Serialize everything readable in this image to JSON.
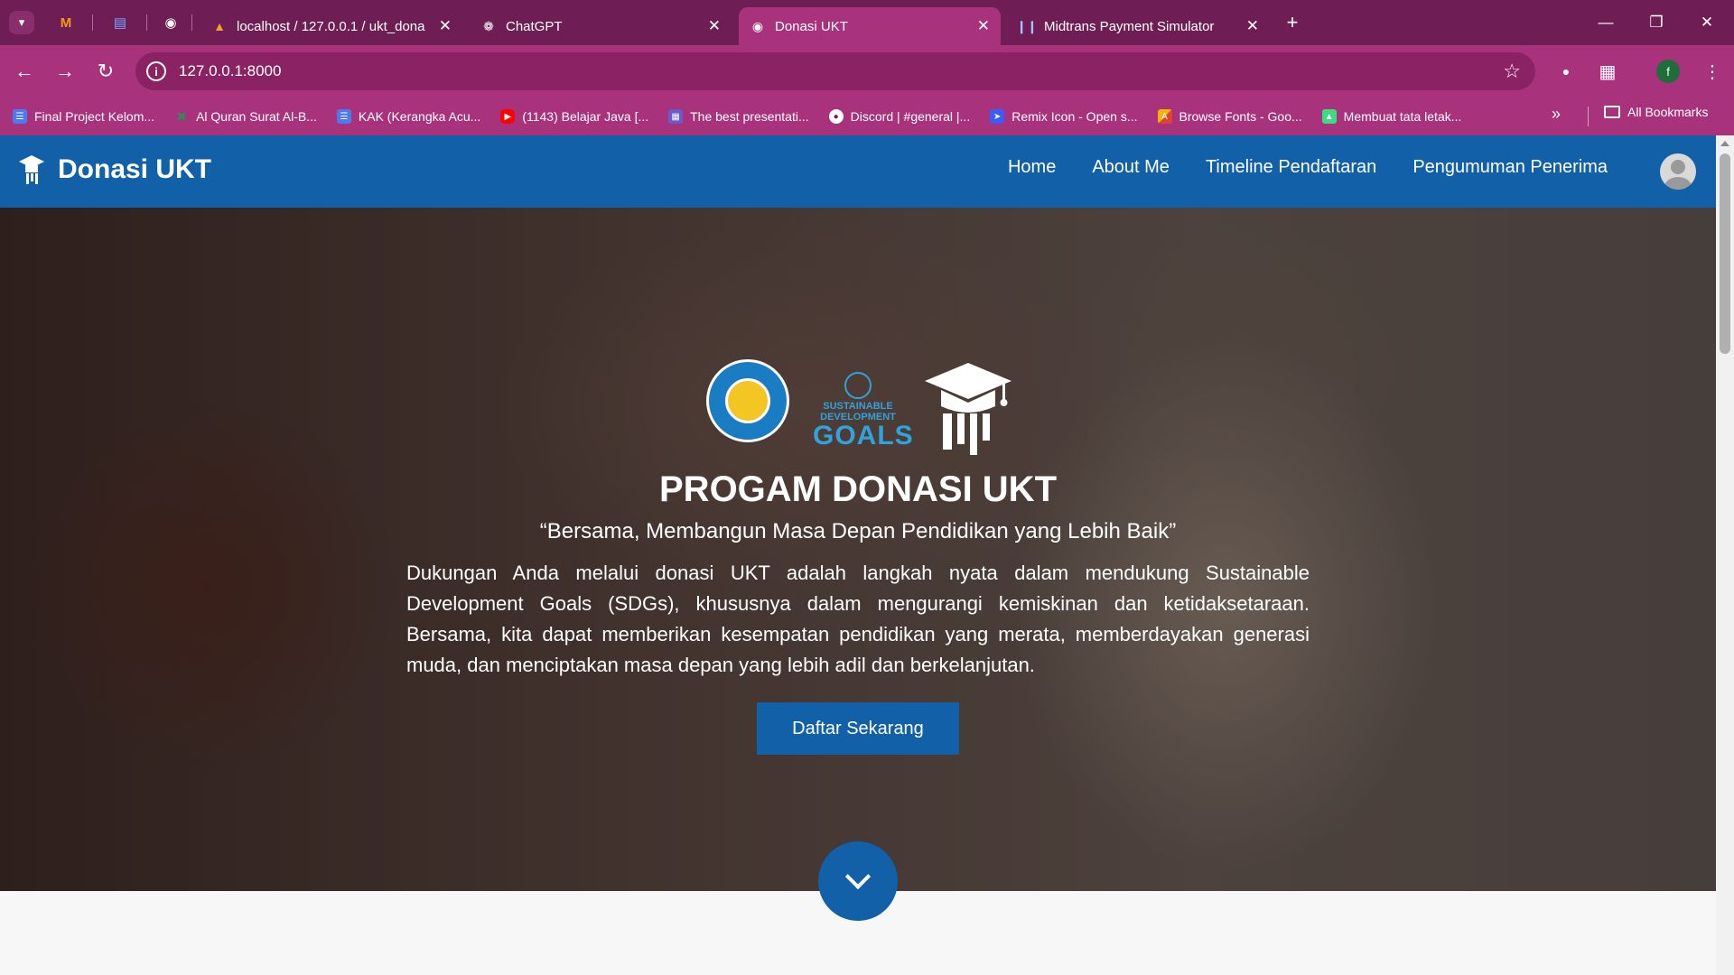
{
  "browser": {
    "tabs": [
      {
        "title": "localhost / 127.0.0.1 / ukt_dona",
        "active": false
      },
      {
        "title": "ChatGPT",
        "active": false
      },
      {
        "title": "Donasi UKT",
        "active": true
      },
      {
        "title": "Midtrans Payment Simulator",
        "active": false
      }
    ],
    "url": "127.0.0.1:8000",
    "profile_initial": "f",
    "bookmarks": [
      {
        "label": "Final Project Kelom...",
        "color": "#4a7cf0"
      },
      {
        "label": "Al Quran Surat Al-B...",
        "color": "#2e8b57"
      },
      {
        "label": "KAK (Kerangka Acu...",
        "color": "#4a7cf0"
      },
      {
        "label": "(1143) Belajar Java [...",
        "color": "#ff0000"
      },
      {
        "label": "The best presentati...",
        "color": "#6a5acd"
      },
      {
        "label": "Discord | #general |...",
        "color": "#ffffff"
      },
      {
        "label": "Remix Icon - Open s...",
        "color": "#3b5cf6"
      },
      {
        "label": "Browse Fonts - Goo...",
        "color": "#f4b400"
      },
      {
        "label": "Membuat tata letak...",
        "color": "#3ddc84"
      }
    ],
    "all_bookmarks": "All Bookmarks"
  },
  "site": {
    "brand": "Donasi UKT",
    "nav": [
      "Home",
      "About Me",
      "Timeline Pendaftaran",
      "Pengumuman Penerima"
    ]
  },
  "hero": {
    "sdg_line1": "SUSTAINABLE",
    "sdg_line2": "DEVELOPMENT",
    "sdg_line3": "GOALS",
    "title": "PROGAM DONASI UKT",
    "tagline": "“Bersama, Membangun Masa Depan Pendidikan yang Lebih Baik”",
    "description": "Dukungan Anda melalui donasi UKT adalah langkah nyata dalam mendukung Sustainable Development Goals (SDGs), khususnya dalam mengurangi kemiskinan dan ketidaksetaraan. Bersama, kita dapat memberikan kesempatan pendidikan yang merata, memberdayakan generasi muda, dan menciptakan masa depan yang lebih adil dan berkelanjutan.",
    "cta": "Daftar Sekarang"
  },
  "colors": {
    "tabbar": "#6e1e55",
    "toolbar": "#a8327c",
    "site_primary": "#1160a8"
  }
}
